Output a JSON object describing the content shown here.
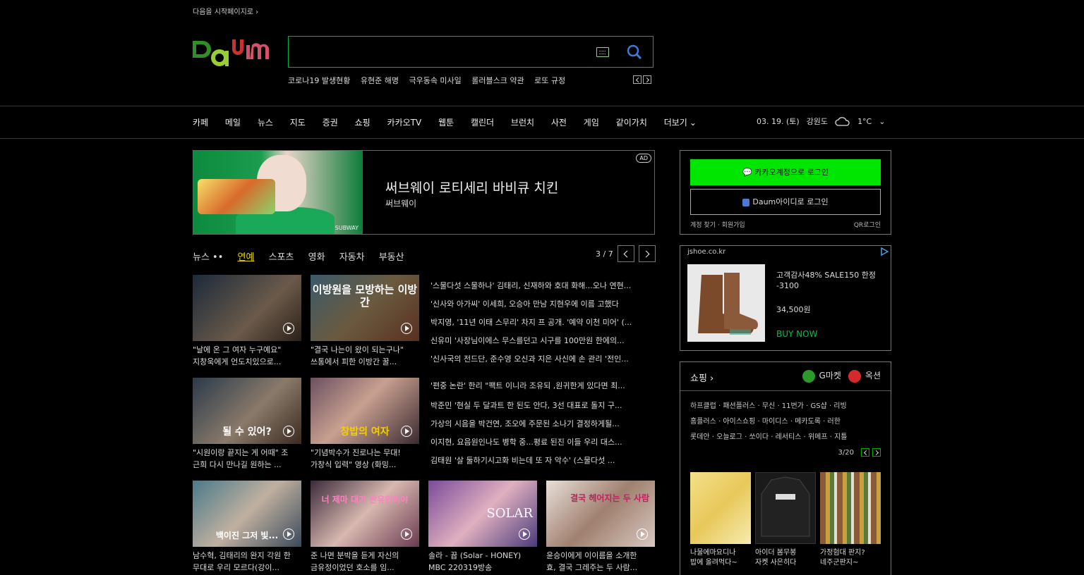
{
  "skip_link": "다음을 시작페이지로 ›",
  "logo_text": "Daum",
  "search": {
    "placeholder": ""
  },
  "trending": [
    "코로나19 발생현황",
    "유현준 해명",
    "극우동속 미사일",
    "롤러블스크 약관",
    "로또 규정"
  ],
  "gnb": [
    "카페",
    "메일",
    "뉴스",
    "지도",
    "증권",
    "쇼핑",
    "카카오TV",
    "웹툰",
    "캘린더",
    "브런치",
    "사전",
    "게임",
    "같이가치",
    "더보기"
  ],
  "weather": {
    "date": "03. 19. (토)",
    "location": "강원도",
    "temp": "1°C"
  },
  "ad_banner": {
    "title": "써브웨이 로티세리 바비큐 치킨",
    "subtitle": "써브웨이",
    "badge": "AD",
    "image_tag": "SUBWAY"
  },
  "news_tabs": {
    "prefix": "뉴스 ••",
    "items": [
      "연예",
      "스포츠",
      "영화",
      "자동차",
      "부동산"
    ],
    "active": "연예"
  },
  "news_pager": "3 / 7",
  "news_cards_row1": [
    {
      "caption1": "\"날에 온 그 여자 누구예요\"",
      "caption2": "지창욱에게 언도치있으로..."
    },
    {
      "caption1": "\"결국 나는이 왔이 되는구나\"",
      "caption2": "쓰통에서 피한 이방간 꿀...",
      "overlay": "이방원을 모방하는 이방간"
    }
  ],
  "news_cards_row2": [
    {
      "caption1": "\"시원이랑 끝지는 게 어때\" 조",
      "caption2": "근희 다시 만나길 원하는 ...",
      "overlay": "될 수 있어?"
    },
    {
      "caption1": "\"기념박수가 진로나는 무대!",
      "caption2": "가창식 입력\" 영상 (화밍...",
      "overlay": "창밥의 여자"
    }
  ],
  "news_cards_row3": [
    {
      "caption1": "남수혁, 김태리의 완지 각원 한",
      "caption2": "무대로 우리 모르다(강이...",
      "overlay": "백이진 그저 빛..."
    },
    {
      "caption1": "준 나면 분박을 듣게 자신의",
      "caption2": "금유정이었던 호소를 임...",
      "overlay": "너 제마 대기 관유인이야"
    },
    {
      "caption1": "솔라 - 뀹 (Solar - HONEY)",
      "caption2": "MBC 220319방송",
      "overlay": "SOLAR"
    },
    {
      "caption1": "윤승이에게 이이름을 소개한",
      "caption2": "효, 결국 그레주는 두 사람...",
      "overlay": "결국 헤어지는 두 사람"
    }
  ],
  "headlines_group1": [
    "'스물다섯 스물하나' 김태리, 신재하와 호대 화해...오나 연현...",
    "'신사와 아가씨' 이세희, 오승아 만남 지현우에 이름 고했다",
    "박지영, '11년 이태 스무리' 차지 프 공개. '예약 이천 미어' (...",
    "신유미 '사장님이에스 무스를던고 시구를 100만원 한에의...",
    "'신사국의 전드단, 준수영 오신과 지은 사신에 손 관리 '전인..."
  ],
  "headlines_group2": [
    "'편중 논란' 한리 \"팩트 이니라 조유되 ,원귀한게 있다면 최...",
    "박준민 '현실 두 달과트 한 된도 안다, 3선 대표로 돌지 구...",
    "가상의 시음을 박건연, 조오에 주문된 소나기 결정하게될...",
    "이지현, 요음원인나도 병학 중...평료 된진 이들 우리 대스...",
    "김태원 '살 둘하기시고화 비는데 또 자 악수' (스물다섯 ..."
  ],
  "login": {
    "kakao": "카카오계정으로 로그인",
    "daum": "Daum아이디로 로그인",
    "link_left": "계정 찾기 · 회원가입",
    "link_right": "QR로그인"
  },
  "ad_side": {
    "domain": "jshoe.co.kr",
    "title": "고객감사48% SALE150 한정 -3100",
    "price": "34,500원",
    "cta": "BUY NOW"
  },
  "shopping": {
    "title": "쇼핑",
    "brands": [
      "G마켓",
      "옥션"
    ],
    "tags_line1": "하프클럽 · 패션플러스 · 무신 · 11번가 · GS샵 · 리빙",
    "tags_line2": "홈플러스 · 아이스쇼핑 · 마이디스 · 메카도록 · 러한",
    "tags_line3": "롯데안 · 오늘로그 · 쏘이다 · 레서티스 · 위메프 · 지틀",
    "pager": "3/20",
    "products": [
      {
        "caption1": "나물에마요디나",
        "caption2": "밥에 올려먹다~"
      },
      {
        "caption1": "아이더 봄무봉",
        "caption2": "자켓 사은히다"
      },
      {
        "caption1": "가정험대 판지?",
        "caption2": "네주군판지~"
      }
    ]
  },
  "colors": {
    "accent_green": "#00b04a",
    "kakao_green": "#00e600",
    "active_tab": "#e6d400"
  }
}
